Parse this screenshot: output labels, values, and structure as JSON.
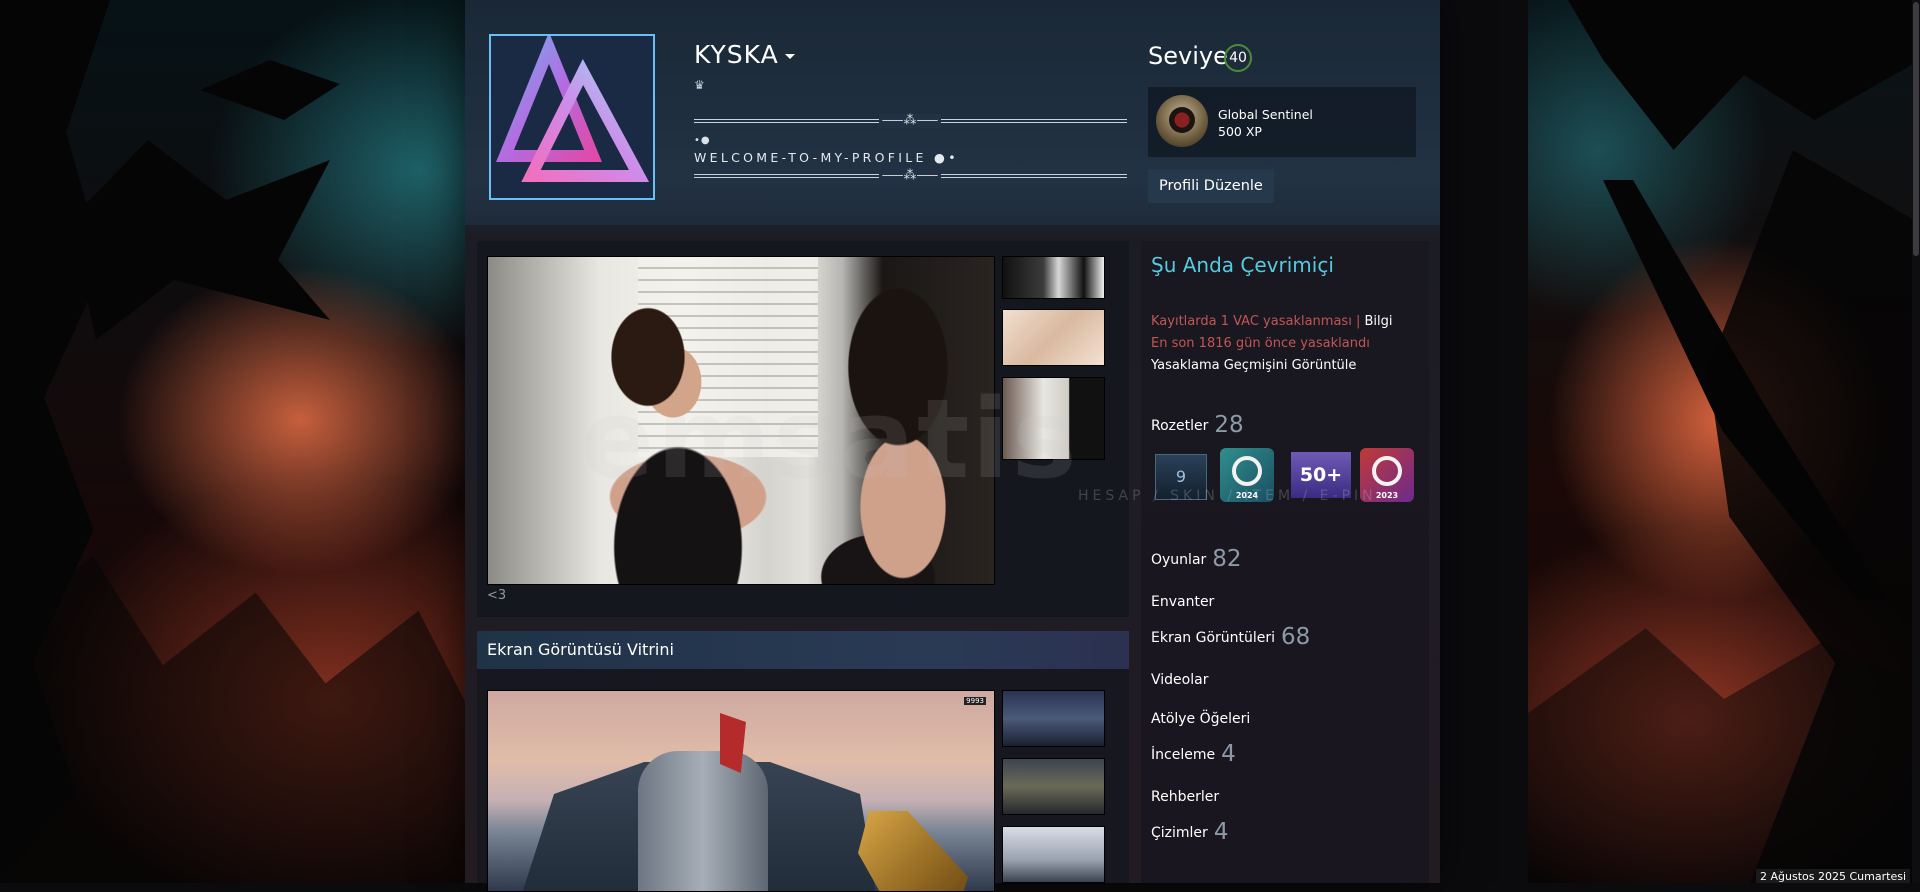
{
  "profile": {
    "persona_name": "KYSKA",
    "crown_glyph": "♛",
    "summary": {
      "ornament": "⸺⁂⸺",
      "dots": "•●",
      "welcome": "WELCOME-TO-MY-PROFILE ●•"
    },
    "level_label": "Seviye",
    "level_value": "40",
    "featured_badge": {
      "name": "Global Sentinel",
      "xp": "500 XP"
    },
    "edit_button": "Profili Düzenle"
  },
  "showcase": {
    "caption": "<3",
    "section_title": "Ekran Görüntüsü Vitrini",
    "hud_text": "9993"
  },
  "sidebar": {
    "status": "Şu Anda Çevrimiçi",
    "vac_count_text": "Kayıtlarda 1 VAC yasaklanması",
    "vac_separator": "|",
    "vac_info_link": "Bilgi",
    "vac_last": "En son 1816 gün önce yasaklandı",
    "vac_history": "Yasaklama Geçmişini Görüntüle",
    "badges": {
      "label": "Rozetler",
      "count": "28",
      "items": [
        {
          "icon": "level-badge-icon",
          "text": "9"
        },
        {
          "icon": "steam-2024-badge-icon",
          "text": "2024"
        },
        {
          "icon": "years-of-service-badge-icon",
          "text": "50+"
        },
        {
          "icon": "steam-2023-badge-icon",
          "text": "2023"
        }
      ]
    },
    "games": {
      "label": "Oyunlar",
      "count": "82"
    },
    "inventory": {
      "label": "Envanter"
    },
    "screenshots": {
      "label": "Ekran Görüntüleri",
      "count": "68"
    },
    "videos": {
      "label": "Videolar"
    },
    "workshop": {
      "label": "Atölye Öğeleri"
    },
    "reviews": {
      "label": "İnceleme",
      "count": "4"
    },
    "guides": {
      "label": "Rehberler"
    },
    "artwork": {
      "label": "Çizimler",
      "count": "4"
    }
  },
  "watermark": {
    "text": "emsatis",
    "sub": "HESAP / SKIN / ITEM / E-PIN"
  },
  "system": {
    "clock": "2 Ağustos 2025 Cumartesi"
  },
  "colors": {
    "online": "#57cbde",
    "vac": "#c15755",
    "level_ring": "#4c8c37",
    "avatar_border": "#67c1f5"
  }
}
